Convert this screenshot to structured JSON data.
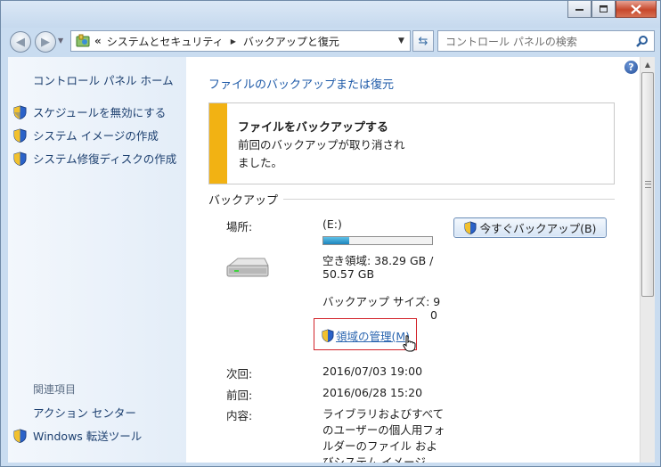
{
  "address": {
    "chevron": "«",
    "crumbs": [
      "システムとセキュリティ",
      "バックアップと復元"
    ]
  },
  "search": {
    "placeholder": "コントロール パネルの検索"
  },
  "sidebar": {
    "home": "コントロール パネル ホーム",
    "tasks": [
      "スケジュールを無効にする",
      "システム イメージの作成",
      "システム修復ディスクの作成"
    ],
    "related_heading": "関連項目",
    "related": [
      "アクション センター",
      "Windows 転送ツール"
    ]
  },
  "main": {
    "title": "ファイルのバックアップまたは復元",
    "notice": {
      "title": "ファイルをバックアップする",
      "body_line1": "前回のバックアップが取り消され",
      "body_line2": "ました。"
    },
    "section_label": "バックアップ",
    "location_label": "場所:",
    "location_value": "(E:)",
    "space_used_fraction": 0.24,
    "free_space_line1": "空き領域: 38.29 GB /",
    "free_space_line2": "50.57 GB",
    "backup_size_label": "バックアップ サイズ: 9",
    "backup_size_overflow": "0",
    "manage_space_link": "領域の管理(M)",
    "backup_now_button": "今すぐバックアップ(B)",
    "next_label": "次回:",
    "next_value": "2016/07/03 19:00",
    "last_label": "前回:",
    "last_value": "2016/06/28 15:20",
    "contents_label": "内容:",
    "contents_lines": [
      "ライブラリおよびすべて",
      "のユーザーの個人用フォ",
      "ルダーのファイル およ",
      "びシステム イメージ"
    ]
  },
  "colors": {
    "link": "#1e5aa8",
    "notice_stripe": "#f2b213",
    "highlight_box": "#d2232a"
  },
  "icons": [
    "back-icon",
    "forward-icon",
    "control-panel-icon",
    "refresh-icon",
    "search-icon",
    "uac-shield-icon",
    "hard-drive-icon",
    "help-icon",
    "hand-cursor-icon"
  ]
}
